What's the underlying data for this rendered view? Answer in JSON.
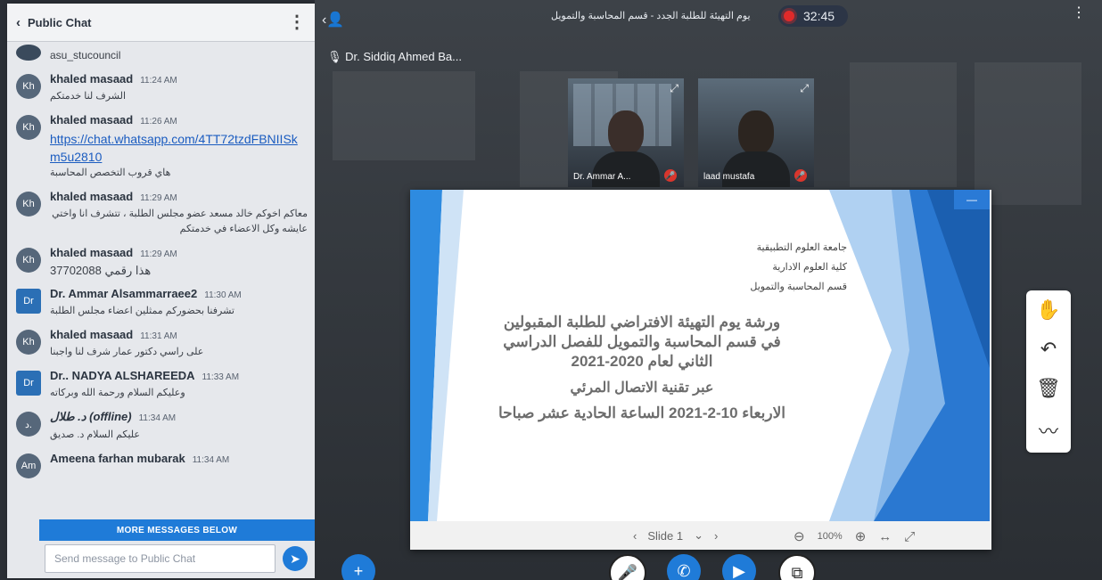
{
  "chat": {
    "title": "Public Chat",
    "more_label": "MORE MESSAGES BELOW",
    "composer_placeholder": "Send message to Public Chat",
    "messages": [
      {
        "initials": "",
        "sender": "",
        "time": "",
        "text": "asu_stucouncil",
        "rtl": false
      },
      {
        "initials": "Kh",
        "sender": "khaled masaad",
        "time": "11:24 AM",
        "text": "الشرف لنا خدمتكم",
        "rtl": true
      },
      {
        "initials": "Kh",
        "sender": "khaled masaad",
        "time": "11:26 AM",
        "link": "https://chat.whatsapp.com/4TT72tzdFBNIISkm5u2810",
        "text": "هاي قروب التخصص المحاسبة",
        "rtl": true
      },
      {
        "initials": "Kh",
        "sender": "khaled masaad",
        "time": "11:29 AM",
        "text": "معاكم اخوكم خالد مسعد عضو مجلس الطلبة ، تتشرف انا واختي عايشه وكل الاعضاء في خدمتكم",
        "rtl": true
      },
      {
        "initials": "Kh",
        "sender": "khaled masaad",
        "time": "11:29 AM",
        "text": "37702088 هذا رقمي",
        "rtl": false
      },
      {
        "initials": "Dr",
        "sender": "Dr. Ammar Alsammarraee2",
        "time": "11:30 AM",
        "text": "تشرفنا بحضوركم ممثلين اعضاء مجلس الطلبة",
        "rtl": true
      },
      {
        "initials": "Kh",
        "sender": "khaled masaad",
        "time": "11:31 AM",
        "text": "على راسي دكتور عمار شرف لنا واجبنا",
        "rtl": true
      },
      {
        "initials": "Dr",
        "sender": "Dr.. NADYA ALSHAREEDA",
        "time": "11:33 AM",
        "text": "وعليكم السلام ورحمة الله وبركاته",
        "rtl": true
      },
      {
        "initials": "د.",
        "sender": "د. طلال (offline)",
        "time": "11:34 AM",
        "text": "عليكم السلام د. صديق",
        "rtl": true
      },
      {
        "initials": "Am",
        "sender": "Ameena farhan mubarak",
        "time": "11:34 AM",
        "text": "",
        "rtl": false
      }
    ]
  },
  "meeting": {
    "title": "يوم التهيئة للطلبة الجدد - قسم المحاسبة والتمويل",
    "timer": "32:45",
    "presenter": "Dr. Siddiq Ahmed Ba...",
    "videos": [
      {
        "name": "Dr. Ammar A..."
      },
      {
        "name": "laad mustafa"
      }
    ]
  },
  "slide": {
    "lines_small": [
      "جامعة العلوم التطبيقية",
      "كلية العلوم الادارية",
      "قسم المحاسبة والتمويل"
    ],
    "title_lines": [
      "ورشة يوم التهيئة الافتراضي للطلبة المقبولين",
      "في قسم المحاسبة والتمويل للفصل الدراسي",
      "الثاني لعام 2020-2021",
      "عبر تقنية الاتصال المرئي",
      "الاربعاء 10-2-2021 الساعة الحادية عشر صباحا"
    ],
    "slide_label": "Slide 1",
    "zoom": "100%"
  },
  "icons": {
    "send": "send-icon",
    "plus": "plus-icon",
    "mic": "mic-off-icon",
    "phone": "phone-icon",
    "camera": "camera-icon",
    "share": "screen-share-icon"
  },
  "colors": {
    "accent": "#1f7bd8",
    "record": "#e02a2a"
  }
}
